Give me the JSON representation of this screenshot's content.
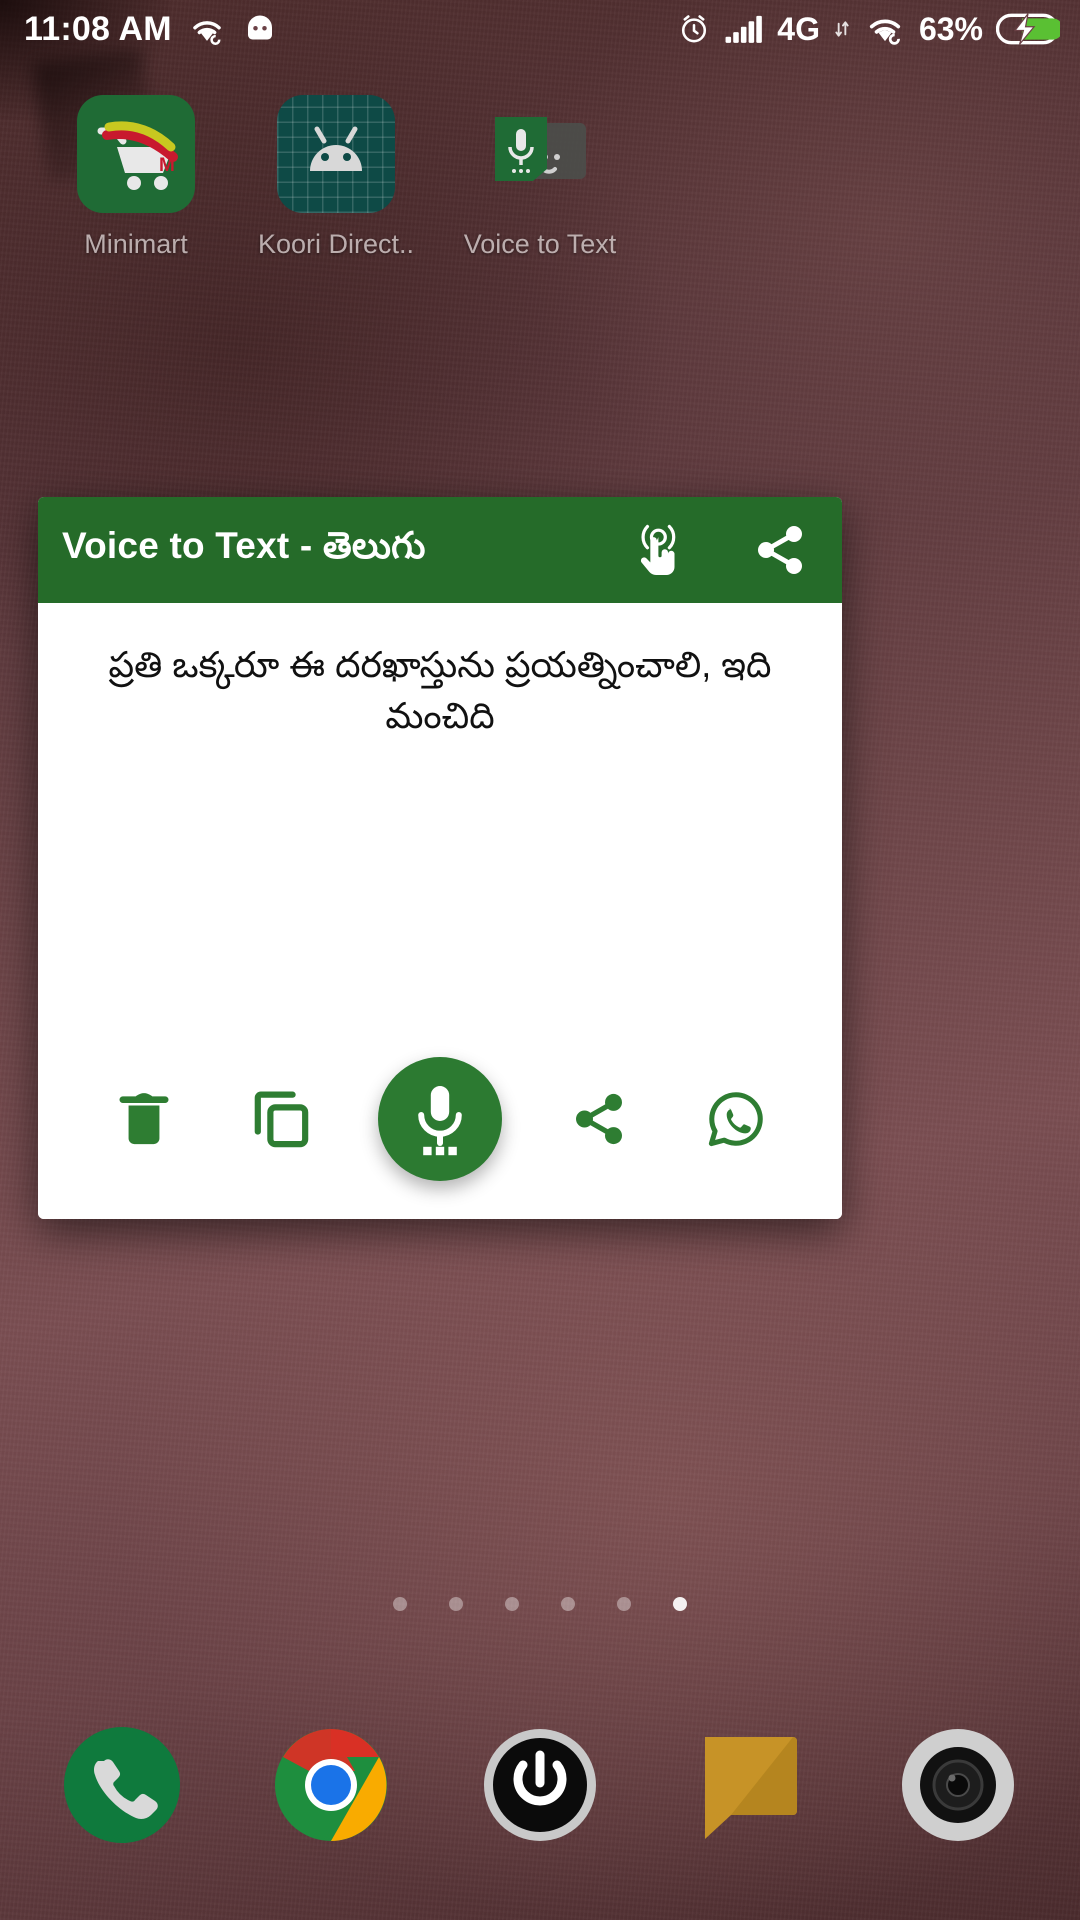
{
  "statusbar": {
    "time": "11:08 AM",
    "battery_percent": "63%",
    "network_label": "4G",
    "icons": {
      "wifi_left": "wifi-icon",
      "android_head": "android-head-icon",
      "alarm": "alarm-icon",
      "signal": "cellular-signal-icon",
      "wifi_right": "wifi-icon",
      "battery": "battery-charging-icon"
    }
  },
  "homescreen": {
    "apps": [
      {
        "label": "Minimart",
        "icon": "shopping-cart-icon"
      },
      {
        "label": "Koori Direct..",
        "icon": "android-robot-icon"
      },
      {
        "label": "Voice to Text",
        "icon": "microphone-icon"
      }
    ],
    "page_dots": {
      "count": 6,
      "active_index": 5
    },
    "dock": [
      {
        "name": "phone",
        "icon": "phone-icon"
      },
      {
        "name": "chrome",
        "icon": "chrome-icon"
      },
      {
        "name": "power",
        "icon": "power-icon"
      },
      {
        "name": "messages",
        "icon": "message-bubble-icon"
      },
      {
        "name": "camera",
        "icon": "camera-lens-icon"
      }
    ]
  },
  "app_card": {
    "title": "Voice to Text - తెలుగు",
    "header_actions": [
      {
        "name": "touch-gesture",
        "icon": "touch-gesture-icon"
      },
      {
        "name": "share",
        "icon": "share-icon"
      }
    ],
    "transcript": "ప్రతి ఒక్కరూ ఈ దరఖాస్తును ప్రయత్నించాలి, ఇది మంచిది",
    "toolbar": [
      {
        "name": "delete",
        "icon": "trash-icon"
      },
      {
        "name": "copy",
        "icon": "copy-icon"
      },
      {
        "name": "record",
        "icon": "microphone-icon"
      },
      {
        "name": "share",
        "icon": "share-icon"
      },
      {
        "name": "whatsapp",
        "icon": "whatsapp-icon"
      }
    ]
  },
  "colors": {
    "brand_green": "#256b29",
    "fab_green": "#2c7a31",
    "icon_green": "#2e7d32",
    "card_bg": "#ffffff",
    "status_text": "#ffffff",
    "battery_green": "#5ac033"
  }
}
